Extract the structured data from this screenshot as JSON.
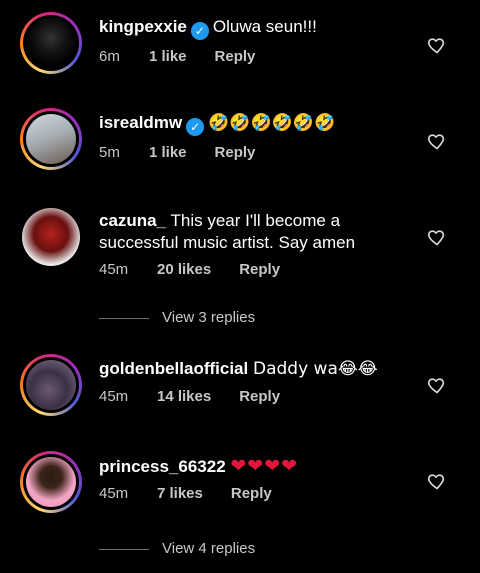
{
  "comments": [
    {
      "username": "kingpexxie",
      "verified": true,
      "text": "Oluwa seun!!!",
      "time": "6m",
      "likes": "1 like",
      "reply": "Reply",
      "ring": true
    },
    {
      "username": "isrealdmw",
      "verified": true,
      "text": "🤣🤣🤣🤣🤣🤣",
      "time": "5m",
      "likes": "1 like",
      "reply": "Reply",
      "ring": true
    },
    {
      "username": "cazuna_",
      "verified": false,
      "text": "This year I'll become a successful music artist. Say amen",
      "time": "45m",
      "likes": "20 likes",
      "reply": "Reply",
      "ring": false,
      "view_replies": "View 3 replies"
    },
    {
      "username": "goldenbellaofficial",
      "verified": false,
      "text": "Daddy wa😂😂",
      "time": "45m",
      "likes": "14 likes",
      "reply": "Reply",
      "ring": true
    },
    {
      "username": "princess_66322",
      "verified": false,
      "text": "❤❤❤❤",
      "time": "45m",
      "likes": "7 likes",
      "reply": "Reply",
      "ring": true,
      "view_replies": "View 4 replies"
    }
  ],
  "colors": {
    "background": "#000000",
    "secondary_text": "#c7c7c7",
    "verified_badge": "#1d9bf0",
    "heart_red": "#e0163a"
  }
}
